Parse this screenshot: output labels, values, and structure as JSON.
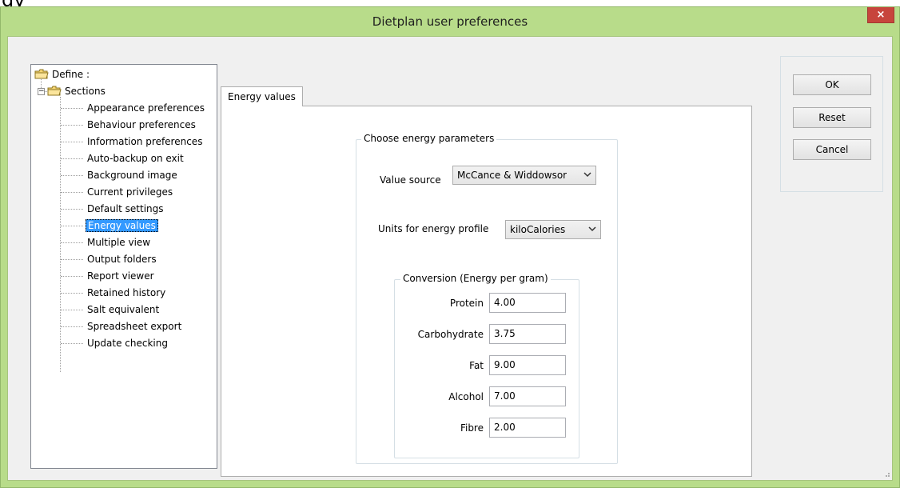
{
  "window": {
    "title": "Dietplan user preferences",
    "close_glyph": "×"
  },
  "background_fragment": "gy",
  "tree": {
    "root": "Define :",
    "sections": "Sections",
    "expander": "−",
    "items": [
      "Appearance preferences",
      "Behaviour preferences",
      "Information preferences",
      "Auto-backup on exit",
      "Background image",
      "Current privileges",
      "Default settings",
      "Energy values",
      "Multiple view",
      "Output folders",
      "Report viewer",
      "Retained history",
      "Salt equivalent",
      "Spreadsheet export",
      "Update checking"
    ],
    "selected_index": 7
  },
  "tab": {
    "label": "Energy values"
  },
  "energy": {
    "group_title": "Choose energy parameters",
    "value_source_label": "Value source",
    "value_source_value": "McCance & Widdowsor",
    "units_label": "Units for energy profile",
    "units_value": "kiloCalories",
    "conversion_title": "Conversion (Energy per gram)",
    "conversion": [
      {
        "label": "Protein",
        "value": "4.00"
      },
      {
        "label": "Carbohydrate",
        "value": "3.75"
      },
      {
        "label": "Fat",
        "value": "9.00"
      },
      {
        "label": "Alcohol",
        "value": "7.00"
      },
      {
        "label": "Fibre",
        "value": "2.00"
      }
    ]
  },
  "buttons": {
    "ok": "OK",
    "reset": "Reset",
    "cancel": "Cancel"
  },
  "icons": {
    "dropdown": "chevron-down-icon",
    "folder": "folder-icon"
  }
}
